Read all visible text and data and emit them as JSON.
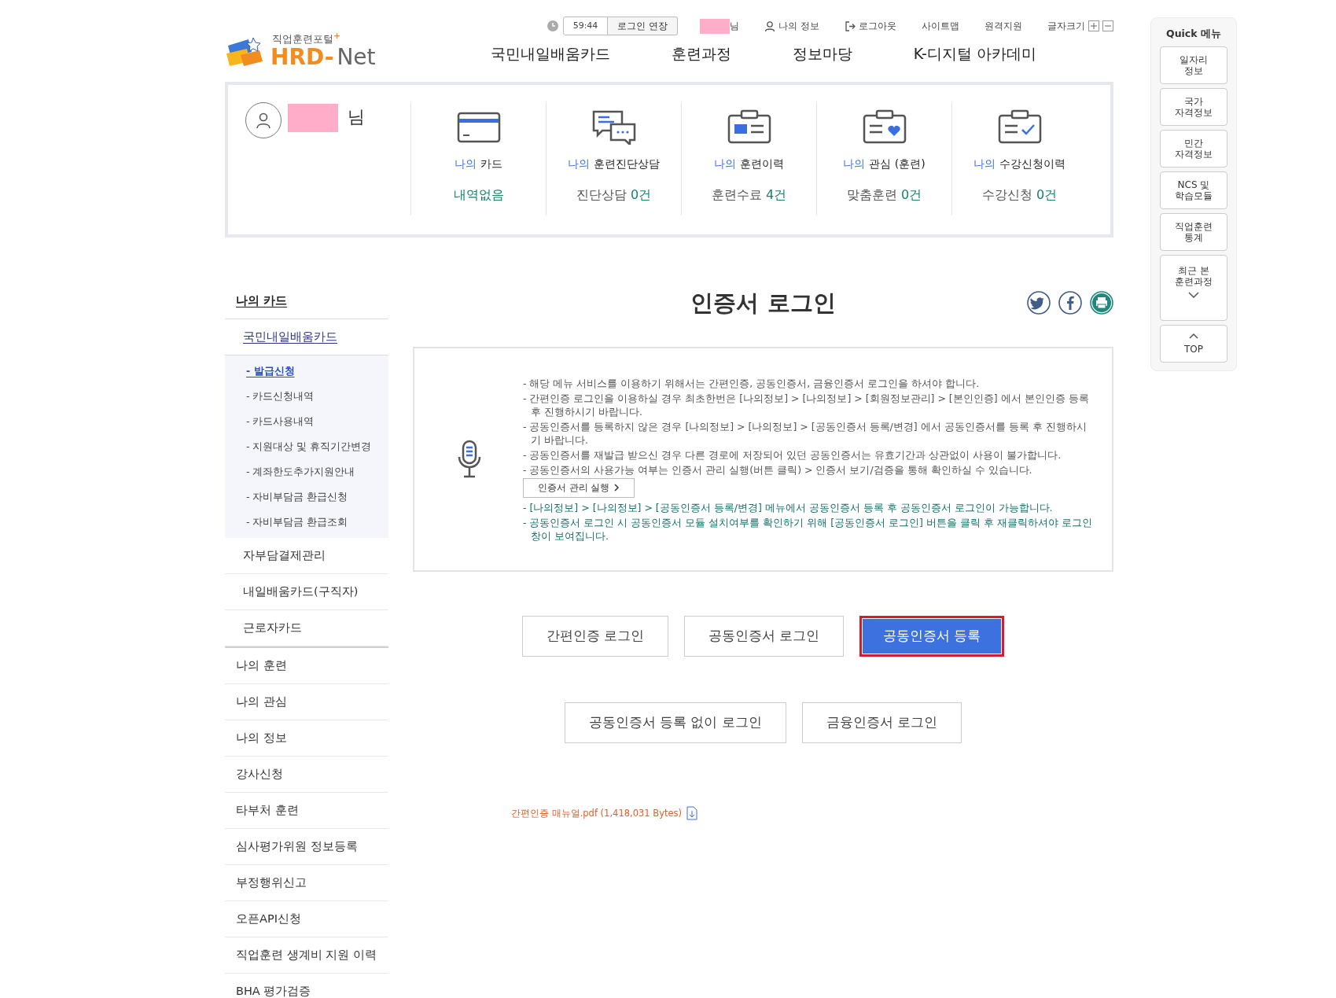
{
  "header": {
    "logo": {
      "tagline": "직업훈련포털$^{+}$",
      "brand": "HRD-",
      "brand_suffix": "Net"
    },
    "utility": {
      "timer": "59:44",
      "extend_button": "로그인 연장",
      "user_suffix": "님",
      "links": [
        {
          "kind": "user",
          "text": "나의 정보"
        },
        {
          "kind": "logout",
          "text": "로그아웃"
        },
        {
          "kind": "plain",
          "text": "사이트맵"
        },
        {
          "kind": "plain",
          "text": "원격지원"
        }
      ],
      "font_size_label": "글자크기"
    },
    "nav": [
      "국민내일배움카드",
      "훈련과정",
      "정보마당",
      "K-디지털 아카데미"
    ]
  },
  "summary": {
    "user_suffix": "님",
    "items": [
      {
        "prefix": "나의",
        "label": "카드",
        "count": "내역없음"
      },
      {
        "prefix": "나의",
        "label": "훈련진단상담",
        "value_label": "진단상담",
        "count": "0건"
      },
      {
        "prefix": "나의",
        "label": "훈련이력",
        "value_label": "훈련수료",
        "count": "4건"
      },
      {
        "prefix": "나의",
        "label": "관심 (훈련)",
        "value_label": "맞춤훈련",
        "count": "0건"
      },
      {
        "prefix": "나의",
        "label": "수강신청이력",
        "value_label": "수강신청",
        "count": "0건"
      }
    ]
  },
  "sidebar": {
    "items": [
      {
        "text": "나의 카드",
        "selected": true,
        "expanded": true,
        "children": [
          {
            "text": "국민내일배움카드",
            "selected": true,
            "expanded": true,
            "children": [
              {
                "text": "- 발급신청",
                "selected": true
              },
              {
                "text": "- 카드신청내역",
                "selected": false
              },
              {
                "text": "- 카드사용내역",
                "selected": false
              },
              {
                "text": "- 지원대상 및 휴직기간변경",
                "selected": false
              },
              {
                "text": "- 계좌한도추가지원안내",
                "selected": false
              },
              {
                "text": "- 자비부담금 환급신청",
                "selected": false
              },
              {
                "text": "- 자비부담금 환급조회",
                "selected": false
              }
            ]
          },
          {
            "text": "자부담결제관리",
            "selected": false
          },
          {
            "text": "내일배움카드(구직자)",
            "selected": false
          },
          {
            "text": "근로자카드",
            "selected": false
          }
        ]
      },
      {
        "text": "나의 훈련",
        "selected": false
      },
      {
        "text": "나의 관심",
        "selected": false
      },
      {
        "text": "나의 정보",
        "selected": false
      },
      {
        "text": "강사신청",
        "selected": false
      },
      {
        "text": "타부처 훈련",
        "selected": false
      },
      {
        "text": "심사평가위원 정보등록",
        "selected": false
      },
      {
        "text": "부정행위신고",
        "selected": false
      },
      {
        "text": "오픈API신청",
        "selected": false
      },
      {
        "text": "직업훈련 생계비 지원 이력",
        "selected": false
      },
      {
        "text": "BHA 평가검증",
        "selected": false
      }
    ]
  },
  "main": {
    "title": "인증서 로그인",
    "notice": [
      {
        "kind": "text",
        "text": "- 해당 메뉴 서비스를 이용하기 위해서는 간편인증, 공동인증서, 금융인증서 로그인을 하셔야 합니다."
      },
      {
        "kind": "text",
        "text": "- 간편인증 로그인을 이용하실 경우 최초한번은 [나의정보] > [나의정보] > [회원정보관리] > [본인인증] 에서 본인인증 등록 후 진행하시기 바랍니다."
      },
      {
        "kind": "text",
        "text": "- 공동인증서를 등록하지 않은 경우 [나의정보] > [나의정보] > [공동인증서 등록/변경] 에서 공동인증서를 등록 후 진행하시기 바랍니다."
      },
      {
        "kind": "text",
        "text": "- 공동인증서를 재발급 받으신 경우 다른 경로에 저장되어 있던 공동인증서는 유효기간과 상관없이 사용이 불가합니다."
      },
      {
        "kind": "text",
        "text": "- 공동인증서의 사용가능 여부는 인증서 관리 실행(버튼 클릭) > 인증서 보기/검증을 통해 확인하실 수 있습니다."
      },
      {
        "kind": "button",
        "text": "인증서 관리 실행"
      },
      {
        "kind": "highlight",
        "text": "- [나의정보] > [나의정보] > [공동인증서 등록/변경] 메뉴에서 공동인증서 등록 후 공동인증서 로그인이 가능합니다."
      },
      {
        "kind": "highlight",
        "text": "- 공동인증서 로그인 시 공동인증서 모듈 설치여부를 확인하기 위해 [공동인증서 로그인] 버튼을 클릭 후 재클릭하셔야 로그인창이 보여집니다."
      }
    ],
    "button_rows": [
      {
        "buttons": [
          {
            "text": "간편인증 로그인",
            "selected": false
          },
          {
            "text": "공동인증서 로그인",
            "selected": false
          },
          {
            "text": "공동인증서 등록",
            "selected": true
          }
        ]
      },
      {
        "buttons": [
          {
            "text": "공동인증서 등록 없이 로그인",
            "selected": false
          },
          {
            "text": "금융인증서 로그인",
            "selected": false
          }
        ]
      }
    ],
    "download": "간편인증 매뉴얼.pdf (1,418,031 Bytes)"
  },
  "quick": {
    "title": "Quick 메뉴",
    "items": [
      {
        "kind": "link",
        "text": "일자리\n정보"
      },
      {
        "kind": "link",
        "text": "국가\n자격정보"
      },
      {
        "kind": "link",
        "text": "민간\n자격정보"
      },
      {
        "kind": "link",
        "text": "NCS 및\n학습모듈"
      },
      {
        "kind": "link",
        "text": "직업훈련\n통계"
      },
      {
        "kind": "recent",
        "text": "최근 본\n훈련과정"
      },
      {
        "kind": "top",
        "text": "TOP"
      }
    ]
  }
}
